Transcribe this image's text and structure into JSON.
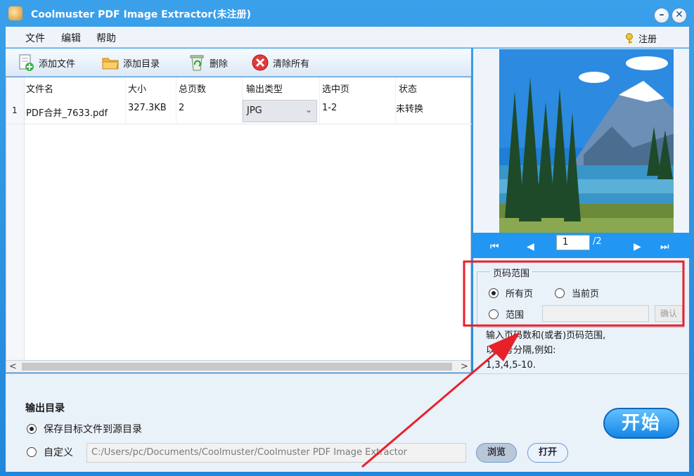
{
  "window": {
    "title": "Coolmuster PDF Image Extractor(未注册)",
    "minimize": "–",
    "close": "✕"
  },
  "menu": {
    "items": [
      "文件",
      "编辑",
      "帮助"
    ],
    "register": "注册"
  },
  "toolbar": {
    "add_file": "添加文件",
    "add_folder": "添加目录",
    "delete": "删除",
    "clear_all": "清除所有"
  },
  "table": {
    "headers": [
      "文件名",
      "大小",
      "总页数",
      "输出类型",
      "选中页",
      "状态"
    ],
    "rows": [
      {
        "index": "1",
        "filename": "PDF合并_7633.pdf",
        "size": "327.3KB",
        "pages": "2",
        "output_type": "JPG",
        "selected_pages": "1-2",
        "status": "未转换"
      }
    ]
  },
  "scrollbar": {
    "left": "<",
    "right": ">"
  },
  "preview": {
    "current_page": "1",
    "total_pages": "/2",
    "nav": {
      "first": "⏮",
      "prev": "◀",
      "next": "▶",
      "last": "⏭"
    }
  },
  "page_range": {
    "legend": "页码范围",
    "all_pages": "所有页",
    "current_page": "当前页",
    "range": "范围",
    "selected": "all_pages",
    "confirm": "确认",
    "hint_lines": [
      "输入页码数和(或者)页码范围,",
      "以逗号分隔,例如:",
      "1,3,4,5-10."
    ]
  },
  "output": {
    "title": "输出目录",
    "save_to_source": "保存目标文件到源目录",
    "custom": "自定义",
    "selected": "save_to_source",
    "path": "C:/Users/pc/Documents/Coolmuster/Coolmuster PDF Image Extractor",
    "browse": "浏览",
    "open": "打开"
  },
  "start_button": "开始",
  "colors": {
    "titlebar": "#2f93e2",
    "nav_bar": "#2196f3",
    "annotation": "#e8202a"
  }
}
